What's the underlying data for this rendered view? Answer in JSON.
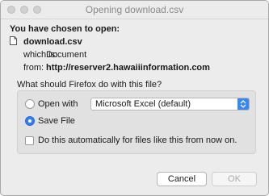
{
  "window": {
    "title": "Opening download.csv"
  },
  "heading": "You have chosen to open:",
  "file": {
    "name": "download.csv",
    "which_is_label": "which is:",
    "which_is_value": "Document",
    "from_label": "from:",
    "from_value": "http://reserver2.hawaiiinformation.com"
  },
  "question": "What should Firefox do with this file?",
  "options": {
    "open_with_label": "Open with",
    "open_with_app": "Microsoft Excel (default)",
    "open_with_selected": false,
    "save_file_label": "Save File",
    "save_file_selected": true
  },
  "auto_checkbox": {
    "label": "Do this automatically for files like this from now on.",
    "checked": false
  },
  "buttons": {
    "cancel": "Cancel",
    "ok": "OK"
  },
  "colors": {
    "accent": "#2f7ff2",
    "panel": "#e1e1e1",
    "window": "#ececec"
  }
}
